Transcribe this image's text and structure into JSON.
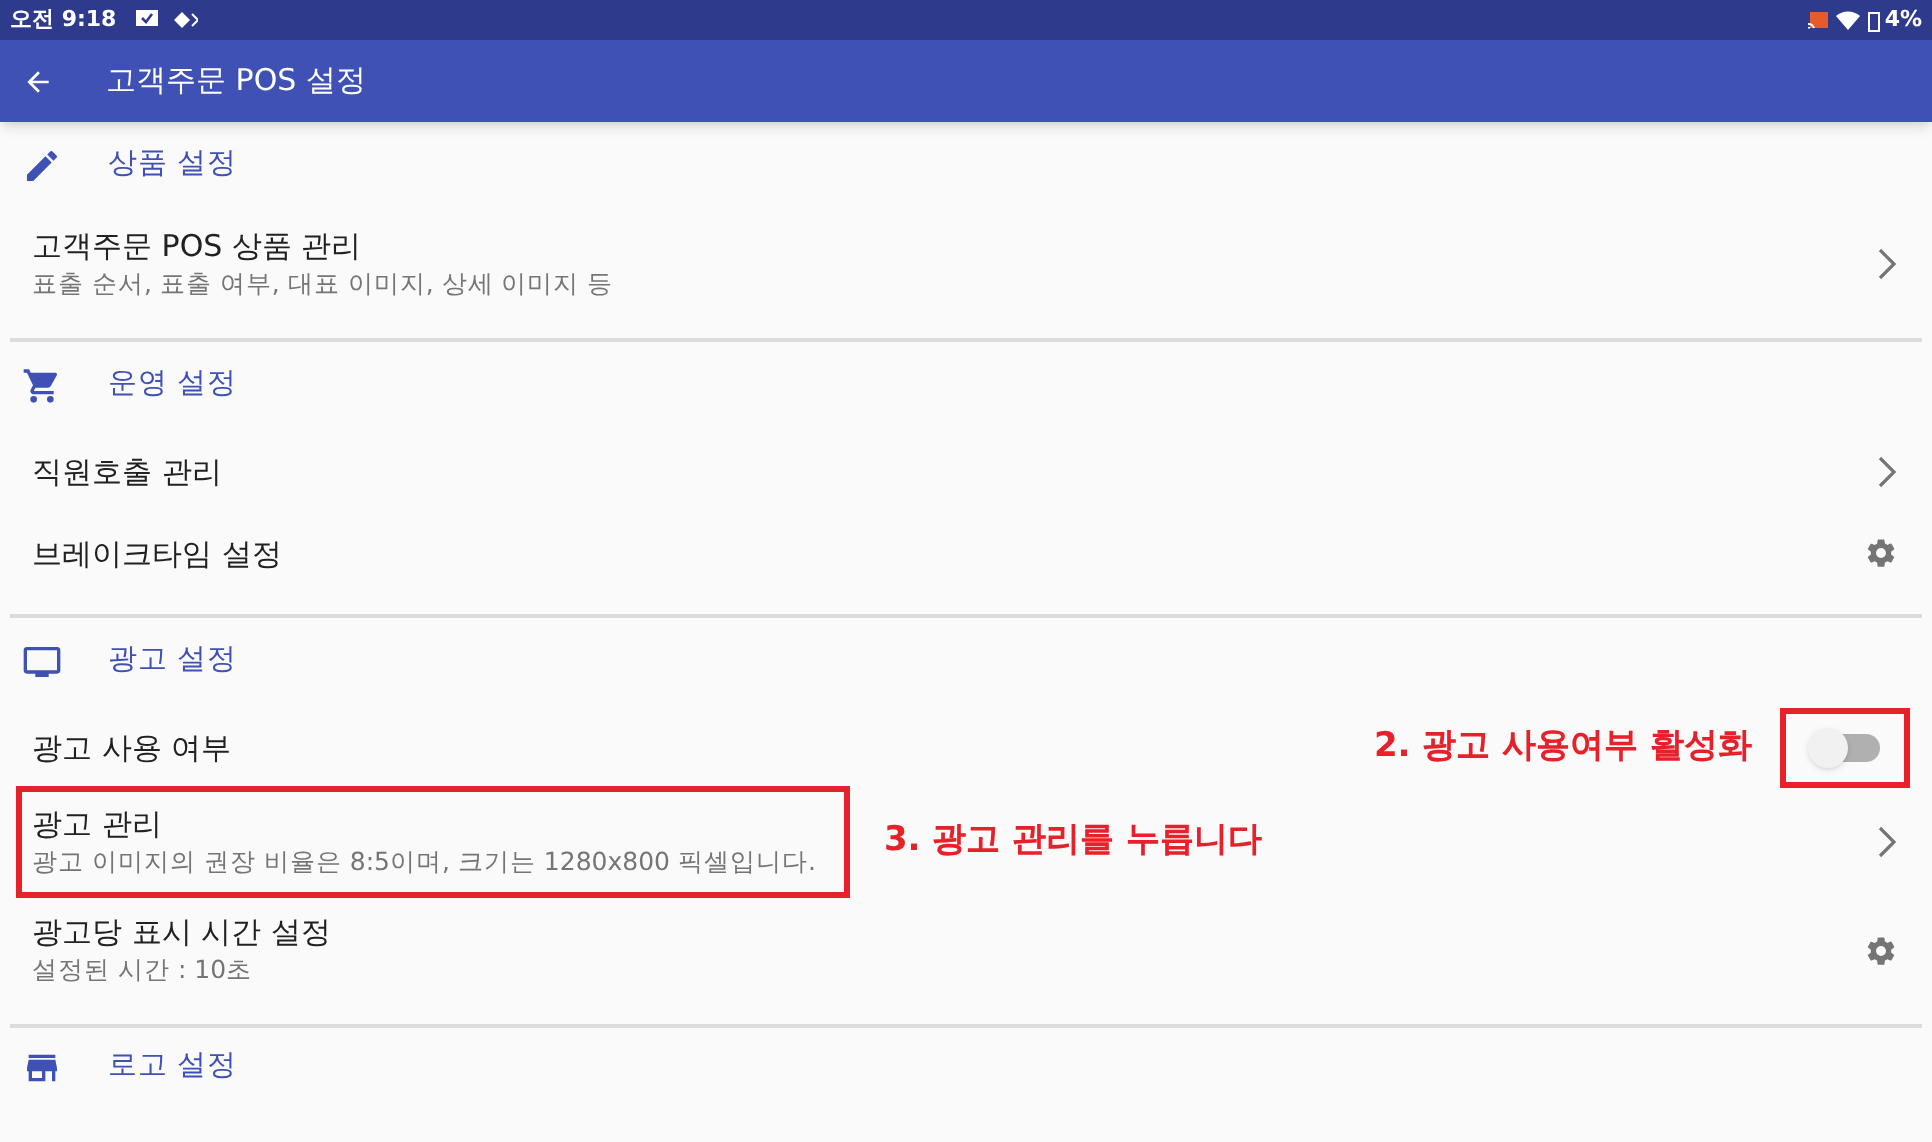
{
  "status_bar": {
    "time": "오전 9:18",
    "battery": "4%"
  },
  "app_bar": {
    "title": "고객주문 POS 설정"
  },
  "sections": [
    {
      "title": "상품 설정",
      "items": [
        {
          "kind": "nav",
          "title": "고객주문 POS 상품 관리",
          "subtitle": "표출 순서, 표출 여부, 대표 이미지, 상세 이미지 등"
        }
      ]
    },
    {
      "title": "운영 설정",
      "items": [
        {
          "kind": "nav",
          "title": "직원호출 관리"
        },
        {
          "kind": "gear",
          "title": "브레이크타임 설정"
        }
      ]
    },
    {
      "title": "광고 설정",
      "items": [
        {
          "kind": "toggle",
          "title": "광고 사용 여부",
          "on": false,
          "callout": "2. 광고 사용여부 활성화"
        },
        {
          "kind": "nav",
          "title": "광고 관리",
          "subtitle": "광고 이미지의 권장 비율은 8:5이며, 크기는 1280x800 픽셀입니다.",
          "callout": "3. 광고 관리를 누릅니다"
        },
        {
          "kind": "gear",
          "title": "광고당 표시 시간 설정",
          "subtitle": "설정된 시간 : 10초"
        }
      ]
    },
    {
      "title": "로고 설정"
    }
  ]
}
